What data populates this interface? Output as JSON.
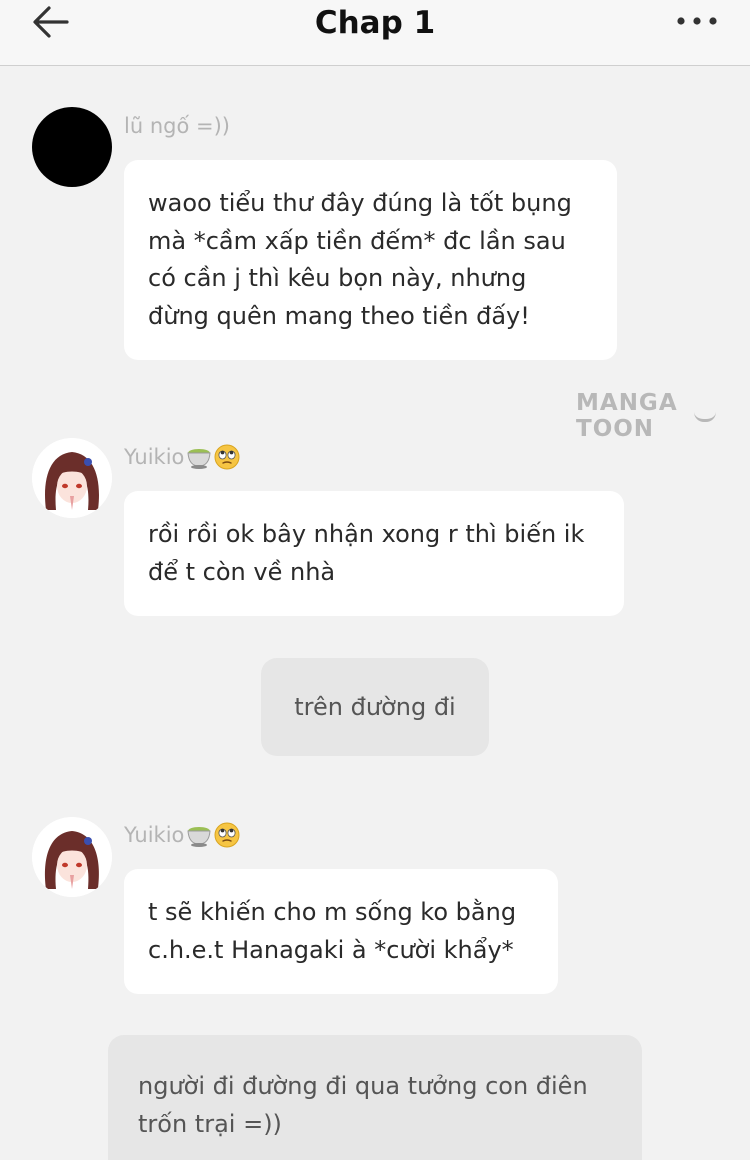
{
  "header": {
    "title": "Chap 1",
    "back_icon": "arrow-left-icon",
    "more_icon": "more-horizontal-icon"
  },
  "messages": [
    {
      "type": "chat",
      "sender": "lũ ngố =))",
      "lines": [
        "waoo tiểu thư đây đúng là tốt bụng",
        "mà *cầm xấp tiền đếm* đc lần sau",
        "có cần j thì kêu bọn này, nhưng",
        "đừng quên mang theo tiền đấy!"
      ]
    },
    {
      "type": "chat",
      "sender": "Yuikio",
      "sender_emojis": [
        "tea-cup-emoji",
        "eye-roll-emoji"
      ],
      "lines": [
        "rồi rồi ok bây nhận xong r thì biến ik",
        "để t còn về nhà"
      ]
    },
    {
      "type": "narration",
      "lines": [
        "trên đường đi"
      ]
    },
    {
      "type": "chat",
      "sender": "Yuikio",
      "sender_emojis": [
        "tea-cup-emoji",
        "eye-roll-emoji"
      ],
      "lines": [
        "t sẽ khiến cho m sống ko bằng",
        "c.h.e.t Hanagaki à *cười khẩy*"
      ]
    },
    {
      "type": "narration",
      "lines": [
        "người đi đường đi qua tưởng con điên",
        "trốn trại =))"
      ]
    }
  ],
  "watermark": "MANGA TOON",
  "colors": {
    "background": "#f2f2f2",
    "bubble": "#ffffff",
    "narration_bubble": "#e6e6e6",
    "sender_name": "#b4b4b4"
  }
}
